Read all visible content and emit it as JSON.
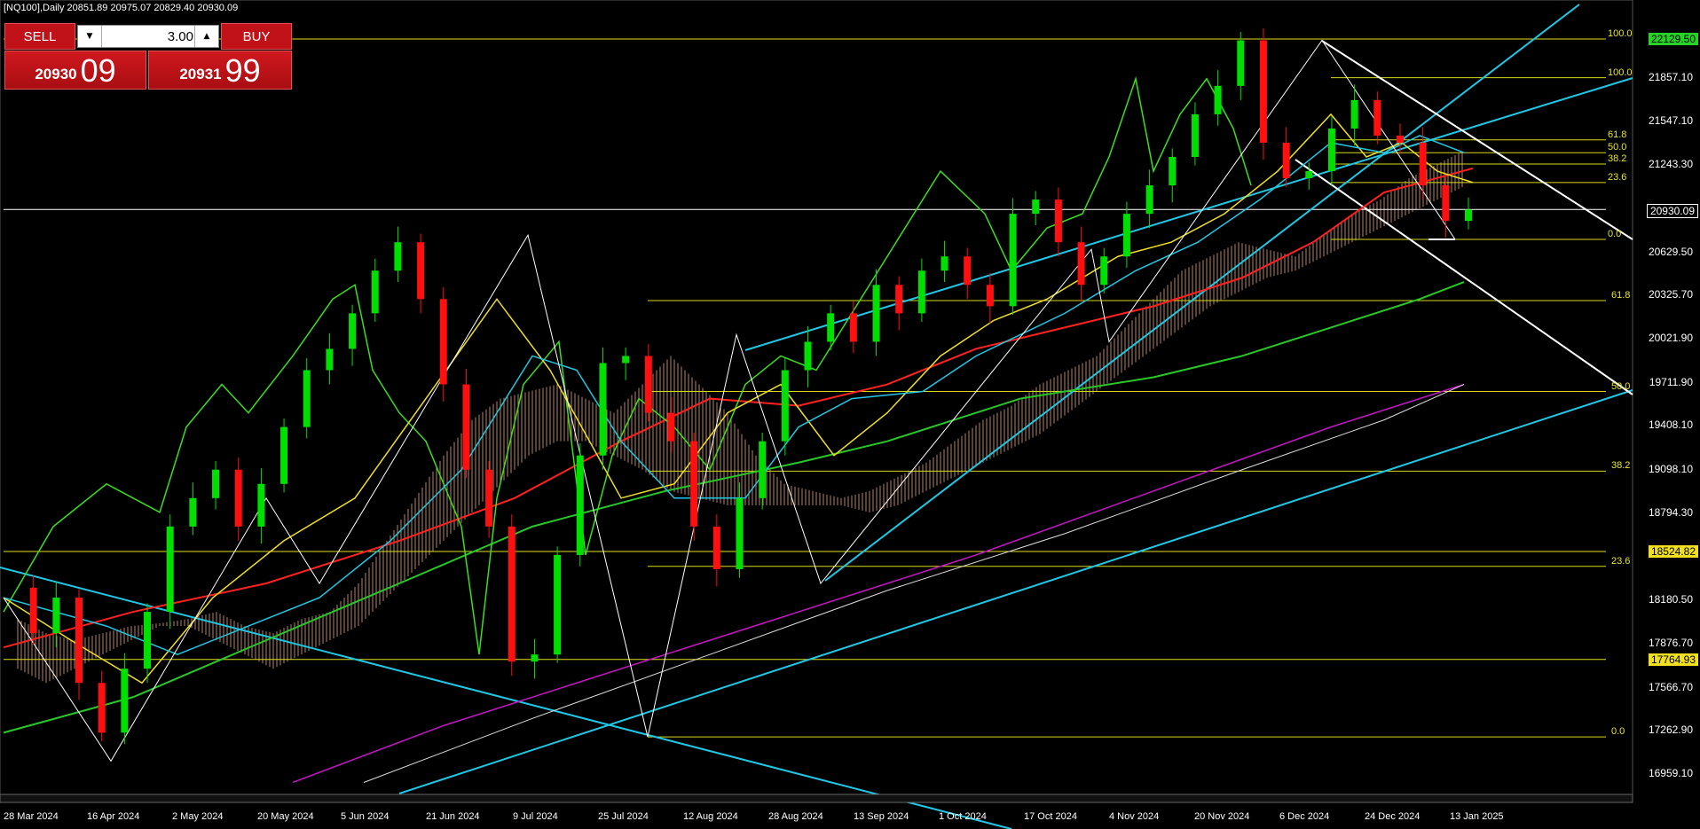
{
  "title": "[NQ100],Daily  20851.89 20975.07 20829.40 20930.09",
  "trade_panel": {
    "sell_label": "SELL",
    "buy_label": "BUY",
    "lot": "3.00",
    "sell_small": "20930",
    "sell_big": "09",
    "buy_small": "20931",
    "buy_big": "99"
  },
  "price_tags": {
    "high_tag": "22129.50",
    "current_tag": "20930.09",
    "mid_tag": "18524.82",
    "low_tag": "17764.93"
  },
  "y_axis_labels": [
    "21857.10",
    "21547.10",
    "21243.30",
    "20629.50",
    "20325.70",
    "20021.90",
    "19711.90",
    "19408.10",
    "19098.10",
    "18794.30",
    "18180.50",
    "17876.70",
    "17566.70",
    "17262.90",
    "16959.10"
  ],
  "x_axis_labels": [
    "28 Mar 2024",
    "16 Apr 2024",
    "2 May 2024",
    "20 May 2024",
    "5 Jun 2024",
    "21 Jun 2024",
    "9 Jul 2024",
    "25 Jul 2024",
    "12 Aug 2024",
    "28 Aug 2024",
    "13 Sep 2024",
    "1 Oct 2024",
    "17 Oct 2024",
    "4 Nov 2024",
    "20 Nov 2024",
    "6 Dec 2024",
    "24 Dec 2024",
    "13 Jan 2025"
  ],
  "fib_upper": [
    "100.0",
    "100.0",
    "61.8",
    "50.0",
    "38.2",
    "23.6",
    "0.0"
  ],
  "fib_lower": [
    "61.8",
    "50.0",
    "38.2",
    "23.6",
    "0.0"
  ],
  "colors": {
    "background": "#000000",
    "bull_candle": "#00e000",
    "bear_candle": "#ff1010",
    "cyan": "#1ec8e6",
    "fib": "#d8d81c",
    "ma_red": "#ff2020",
    "ma_green": "#28c828",
    "ma_magenta": "#c814c8",
    "chikou": "#3ae01a",
    "cloud": "#e8a878"
  },
  "chart_data": {
    "type": "candlestick",
    "symbol": "[NQ100]",
    "timeframe": "Daily",
    "ohlc_last": {
      "open": 20851.89,
      "high": 20975.07,
      "low": 20829.4,
      "close": 20930.09
    },
    "ylim": [
      16800,
      22300
    ],
    "x": [
      "28 Mar 2024",
      "16 Apr 2024",
      "2 May 2024",
      "20 May 2024",
      "5 Jun 2024",
      "21 Jun 2024",
      "9 Jul 2024",
      "25 Jul 2024",
      "12 Aug 2024",
      "28 Aug 2024",
      "13 Sep 2024",
      "1 Oct 2024",
      "17 Oct 2024",
      "4 Nov 2024",
      "20 Nov 2024",
      "6 Dec 2024",
      "24 Dec 2024",
      "13 Jan 2025"
    ],
    "close_path": [
      18270,
      17950,
      18200,
      17600,
      17250,
      17700,
      18100,
      18700,
      18900,
      19100,
      18700,
      19000,
      19400,
      19800,
      19950,
      20200,
      20500,
      20700,
      20300,
      19700,
      19100,
      18700,
      17750,
      17800,
      18500,
      19200,
      19850,
      19900,
      19500,
      19300,
      18700,
      18400,
      18900,
      19300,
      19800,
      20000,
      20200,
      20000,
      20400,
      20200,
      20500,
      20600,
      20400,
      20250,
      20900,
      21000,
      20700,
      20400,
      20600,
      20900,
      21100,
      21300,
      21600,
      21800,
      22120,
      21400,
      21150,
      21200,
      21500,
      21700,
      21450,
      21400,
      21100,
      20850,
      20930
    ],
    "fib_levels": {
      "upper_swing": {
        "100.0": 22129.5,
        "61.8": 21420,
        "50.0": 21330,
        "38.2": 21250,
        "23.6": 21120,
        "0.0": 20720
      },
      "lower_swing": {
        "61.8": 20290,
        "50.0": 19650,
        "38.2": 19090,
        "23.6": 18420,
        "0.0": 17220
      }
    },
    "horizontal_levels": [
      22129.5,
      20930.09,
      18524.82,
      17764.93
    ]
  }
}
